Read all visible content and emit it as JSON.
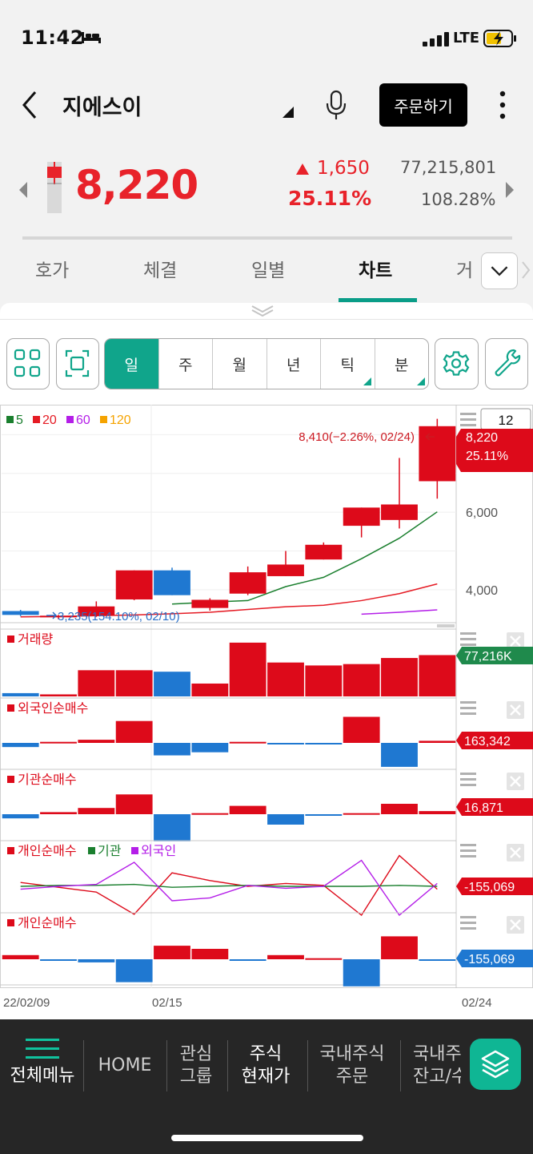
{
  "status_bar": {
    "time": "11:42",
    "network": "LTE"
  },
  "header": {
    "title": "지에스이",
    "order_button": "주문하기"
  },
  "quote": {
    "price": "8,220",
    "change": "1,650",
    "change_pct": "25.11%",
    "volume": "77,215,801",
    "volume_pct": "108.28%"
  },
  "tabs": [
    {
      "label": "호가"
    },
    {
      "label": "체결"
    },
    {
      "label": "일별"
    },
    {
      "label": "차트",
      "selected": true
    },
    {
      "label": "거"
    }
  ],
  "toolbar": {
    "periods": [
      {
        "label": "일",
        "selected": true,
        "corner": false
      },
      {
        "label": "주",
        "selected": false,
        "corner": false
      },
      {
        "label": "월",
        "selected": false,
        "corner": false
      },
      {
        "label": "년",
        "selected": false,
        "corner": false
      },
      {
        "label": "틱",
        "selected": false,
        "corner": true
      },
      {
        "label": "분",
        "selected": false,
        "corner": true
      }
    ]
  },
  "chart_data": {
    "type": "candlestick",
    "candle_count_field": "12",
    "moving_averages": [
      {
        "name": "5",
        "color": "#1a7f2e"
      },
      {
        "name": "20",
        "color": "#e51b24"
      },
      {
        "name": "60",
        "color": "#b41ee8"
      },
      {
        "name": "120",
        "color": "#f5a300"
      }
    ],
    "candles": [
      {
        "open": 3450,
        "close": 3350,
        "high": 3480,
        "low": 3320
      },
      {
        "open": 3320,
        "close": 3330,
        "high": 3350,
        "low": 3240
      },
      {
        "open": 3330,
        "close": 3570,
        "high": 3700,
        "low": 3300
      },
      {
        "open": 3750,
        "close": 4500,
        "high": 4500,
        "low": 3730
      },
      {
        "open": 4500,
        "close": 3860,
        "high": 4570,
        "low": 3860
      },
      {
        "open": 3530,
        "close": 3740,
        "high": 3780,
        "low": 3460
      },
      {
        "open": 3900,
        "close": 4450,
        "high": 4600,
        "low": 3860
      },
      {
        "open": 4350,
        "close": 4650,
        "high": 5000,
        "low": 4350
      },
      {
        "open": 4780,
        "close": 5160,
        "high": 5220,
        "low": 4780
      },
      {
        "open": 5650,
        "close": 6120,
        "high": 6120,
        "low": 5350
      },
      {
        "open": 5800,
        "close": 6200,
        "high": 7400,
        "low": 5580
      },
      {
        "open": 6800,
        "close": 8220,
        "high": 8410,
        "low": 6350
      }
    ],
    "ma5": [
      null,
      null,
      null,
      null,
      3630,
      3680,
      3720,
      4080,
      4320,
      4800,
      5330,
      6010
    ],
    "ma20": [
      3300,
      3310,
      3330,
      3350,
      3380,
      3420,
      3490,
      3560,
      3600,
      3720,
      3900,
      4150
    ],
    "ma60": [
      null,
      null,
      null,
      null,
      null,
      null,
      null,
      null,
      null,
      3370,
      3420,
      3480
    ],
    "y_ticks": [
      "6,000",
      "4,000"
    ],
    "y_tick_values": [
      6000,
      4000
    ],
    "y_range": [
      3150,
      8650
    ],
    "current_price_label": "8,220",
    "current_pct_label": "25.11%",
    "max_annotation": "8,410(−2.26%, 02/24)",
    "min_annotation": "3,235(154.10%, 02/10)",
    "x_labels": [
      "22/02/09",
      "02/15",
      "02/24"
    ],
    "panels": [
      {
        "id": "volume",
        "title": "거래량",
        "value_label": "77,216K",
        "label_color": "#1f8a4c",
        "values": [
          4200,
          2600,
          33600,
          33600,
          31700,
          16500,
          69000,
          43500,
          39700,
          41500,
          49300,
          53000
        ]
      },
      {
        "id": "foreign",
        "title": "외국인순매수",
        "value_label": "163,342",
        "label_color": "#dd0a1a",
        "values": [
          -4,
          1,
          3,
          21,
          -12,
          -9,
          1,
          -1,
          -1,
          25,
          -23,
          2
        ]
      },
      {
        "id": "institution",
        "title": "기관순매수",
        "value_label": "16,871",
        "label_color": "#dd0a1a",
        "values": [
          -4,
          2,
          6,
          19,
          -26,
          1,
          8,
          -10,
          -1,
          1,
          10,
          3
        ]
      },
      {
        "id": "net_lines",
        "title": "개인순매수",
        "legend": [
          {
            "name": "기관",
            "color": "#1a7f2e"
          },
          {
            "name": "외국인",
            "color": "#b41ee8"
          }
        ],
        "value_label": "-155,069",
        "label_color": "#dd0a1a",
        "individual": [
          4,
          -1,
          -6,
          -29,
          14,
          6,
          0,
          3,
          1,
          -30,
          32,
          -3
        ],
        "institution_line": [
          0,
          1,
          1,
          2,
          -1,
          0,
          1,
          0,
          0,
          0,
          1,
          0
        ],
        "foreign_line": [
          -3,
          0,
          2,
          25,
          -15,
          -12,
          1,
          -2,
          0,
          27,
          -30,
          3
        ]
      },
      {
        "id": "individual",
        "title": "개인순매수",
        "value_label": "-155,069",
        "label_color": "#1f78d1",
        "values": [
          4,
          -1,
          -3,
          -22,
          13,
          10,
          -1,
          4,
          1,
          -26,
          22,
          -1
        ]
      }
    ]
  },
  "bottom_nav": {
    "items": [
      {
        "line1": "전체메뉴",
        "line2": ""
      },
      {
        "line1": "HOME",
        "line2": ""
      },
      {
        "line1": "관심",
        "line2": "그룹"
      },
      {
        "line1": "주식",
        "line2": "현재가"
      },
      {
        "line1": "국내주식",
        "line2": "주문"
      },
      {
        "line1": "국내주",
        "line2": "잔고/수"
      }
    ]
  }
}
